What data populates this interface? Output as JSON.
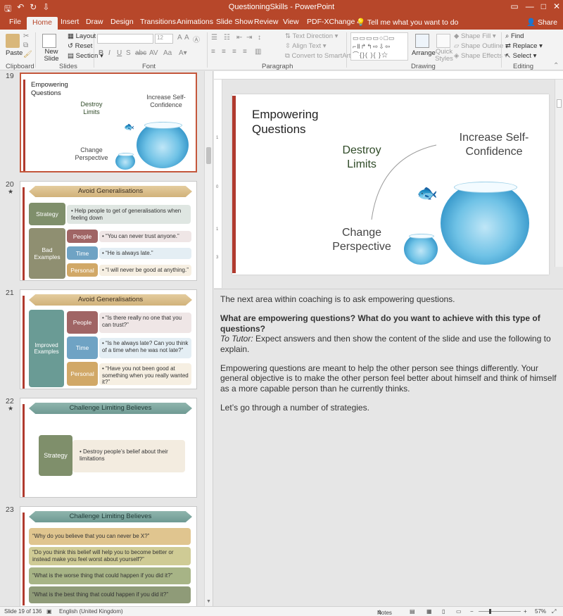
{
  "window": {
    "title": "QuestioningSkills  -  PowerPoint",
    "controls": [
      "—",
      "□",
      "✕"
    ]
  },
  "tabs": [
    "File",
    "Home",
    "Insert",
    "Draw",
    "Design",
    "Transitions",
    "Animations",
    "Slide Show",
    "Review",
    "View",
    "PDF-XChange 4"
  ],
  "active_tab": "Home",
  "tell_me": "Tell me what you want to do",
  "share": "Share",
  "ribbon": {
    "clipboard": {
      "label": "Clipboard",
      "paste": "Paste"
    },
    "slides": {
      "label": "Slides",
      "new_slide": "New Slide",
      "layout": "Layout",
      "reset": "Reset",
      "section": "Section"
    },
    "font": {
      "label": "Font",
      "size": "12"
    },
    "paragraph": {
      "label": "Paragraph",
      "text_direction": "Text Direction",
      "align_text": "Align Text",
      "convert": "Convert to SmartArt"
    },
    "drawing": {
      "label": "Drawing",
      "arrange": "Arrange",
      "quick_styles": "Quick Styles",
      "shape_fill": "Shape Fill",
      "shape_outline": "Shape Outline",
      "shape_effects": "Shape Effects"
    },
    "editing": {
      "label": "Editing",
      "find": "Find",
      "replace": "Replace",
      "select": "Select"
    }
  },
  "thumbnails": {
    "s19": {
      "num": "19",
      "title": "Empowering Questions",
      "destroy": "Destroy Limits",
      "increase": "Increase Self-Confidence",
      "change": "Change Perspective"
    },
    "s20": {
      "num": "20",
      "star": "★",
      "banner": "Avoid Generalisations",
      "strategy": "Strategy",
      "strategy_text": "• Help people to get of generalisations when feeling down",
      "bad": "Bad Examples",
      "rows": [
        {
          "label": "People",
          "text": "• “You can never trust anyone.”"
        },
        {
          "label": "Time",
          "text": "• “He is always late.”"
        },
        {
          "label": "Personal",
          "text": "• “I will never be good at anything.”"
        }
      ]
    },
    "s21": {
      "num": "21",
      "banner": "Avoid Generalisations",
      "improved": "Improved Examples",
      "rows": [
        {
          "label": "People",
          "text": "• “Is there really no one that you can trust?”"
        },
        {
          "label": "Time",
          "text": "• “Is he always late? Can you think of a time when he was not late?”"
        },
        {
          "label": "Personal",
          "text": "• “Have you not been good at something when you really wanted it?”"
        }
      ]
    },
    "s22": {
      "num": "22",
      "star": "★",
      "banner": "Challenge Limiting Believes",
      "strategy": "Strategy",
      "text": "• Destroy people’s belief about their limitations"
    },
    "s23": {
      "num": "23",
      "banner": "Challenge Limiting Believes",
      "items": [
        "“Why do you believe that you can never be X?”",
        "“Do you think this belief will help you to become better or instead make you feel worst about yourself?”",
        "“What is the worse thing that could happen if you did it?”",
        "“What is the best thing that could happen if you did it?”"
      ]
    }
  },
  "slide": {
    "title": "Empowering Questions",
    "destroy": "Destroy Limits",
    "increase": "Increase Self-Confidence",
    "change": "Change Perspective"
  },
  "notes": {
    "p1": "The next area within coaching is to ask empowering questions.",
    "p2_bold": "What are empowering questions? What do you want to achieve with this type of questions?",
    "p2_italic": "To Tutor:",
    "p2_rest": " Expect answers and then show the content of the slide and use the following to explain.",
    "p3": "Empowering questions are meant to help the other person see things differently. Your general objective is to make the other person feel better about himself and think of himself as a more capable person than he currently thinks.",
    "p4": "Let’s go through a number of strategies."
  },
  "status": {
    "slide": "Slide 19 of 136",
    "language": "English (United Kingdom)",
    "notes": "Notes",
    "zoom": "57%"
  },
  "colors": {
    "accent": "#b7472a",
    "strategy_green": "#7f8f6b",
    "people": "#a06565",
    "time": "#6fa3c4",
    "personal": "#d1a867"
  }
}
